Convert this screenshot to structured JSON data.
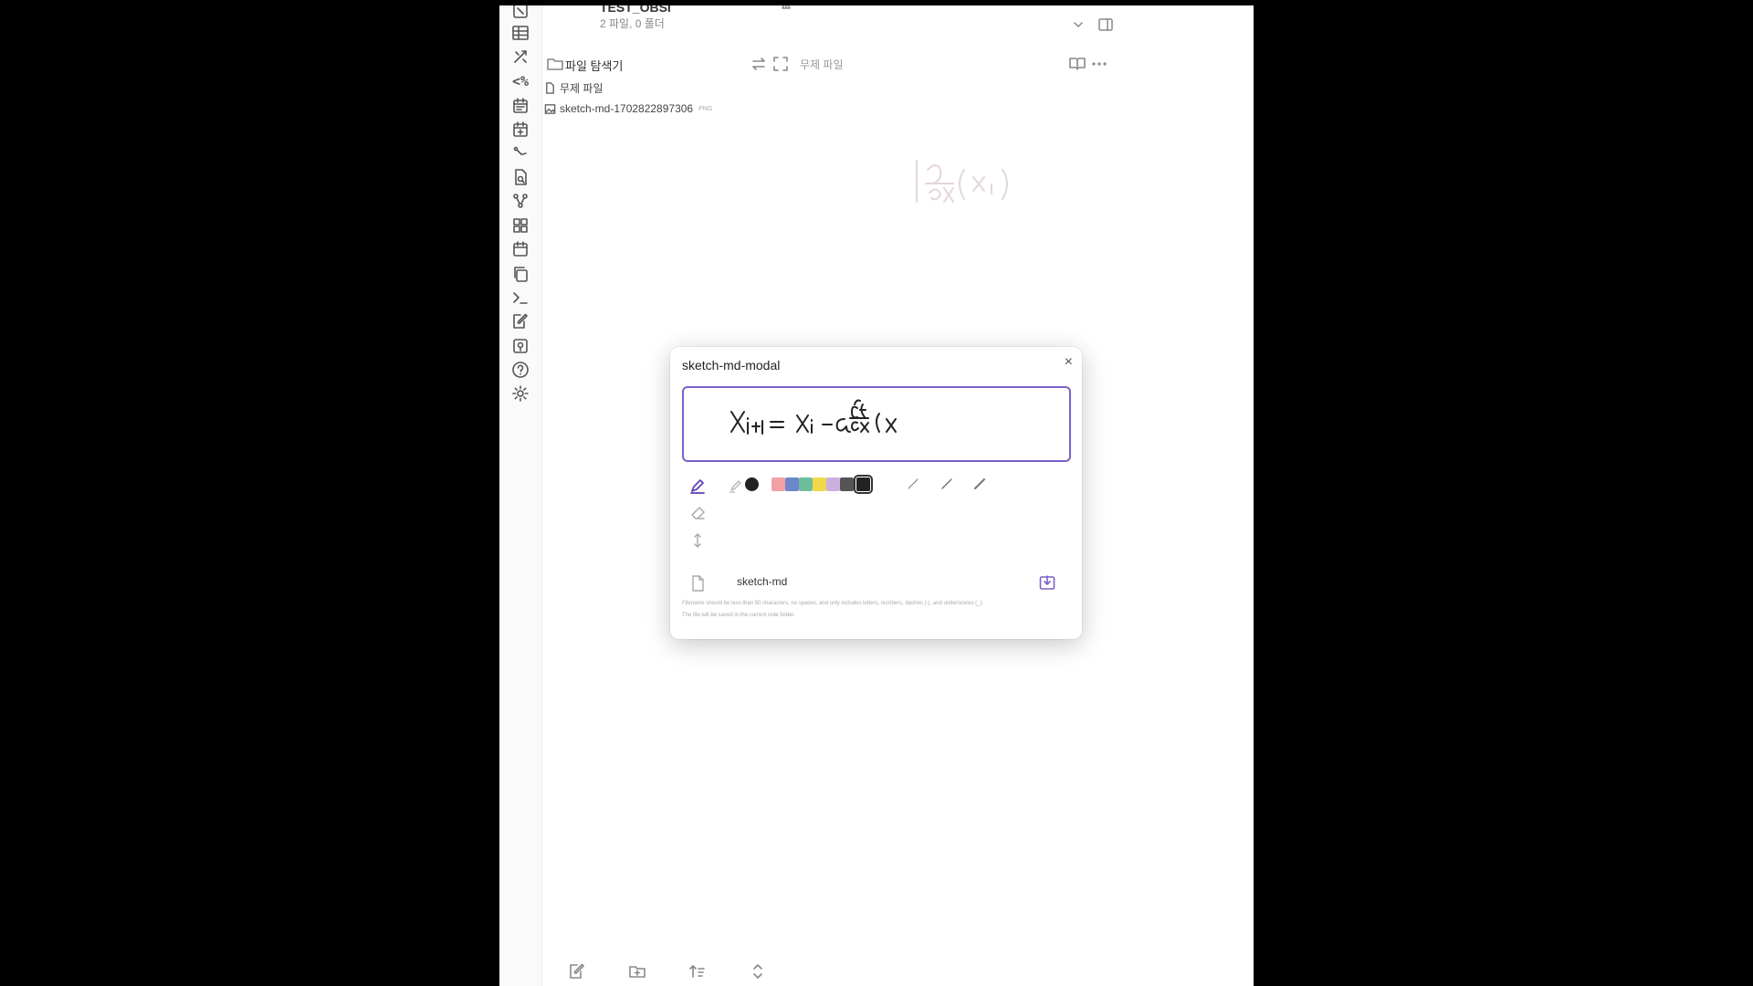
{
  "vault": {
    "name": "TEST_OBSI",
    "subtitle": "2 파일, 0 폴더"
  },
  "pane": {
    "title": "파일 탐색기",
    "tab_label": "무제 파일"
  },
  "files": [
    {
      "name": "무제 파일",
      "ext": "",
      "icon": "file-icon"
    },
    {
      "name": "sketch-md-1702822897306",
      "ext": "PNG",
      "icon": "image-icon"
    }
  ],
  "ribbon_icons": [
    "switcher-icon",
    "table-icon",
    "tools-icon",
    "templater-icon",
    "daily-note-icon",
    "calendar-plus-icon",
    "git-icon",
    "search-file-icon",
    "graph-icon",
    "dashboard-icon",
    "calendar-icon",
    "copy-icon",
    "terminal-icon",
    "edit-note-icon",
    "map-pin-icon",
    "help-icon",
    "settings-icon"
  ],
  "modal": {
    "title": "sketch-md-modal",
    "close": "×",
    "filename": "sketch-md",
    "hint1": "Filename should be less than 50 characters, no spaces, and only includes letters, numbers, dashes (-), and underscores (_).",
    "hint2": "The file will be saved in the current note folder."
  },
  "colors": {
    "accent": "#7b61c9",
    "palette": [
      "#f2a0a6",
      "#6d86c9",
      "#6cbf9a",
      "#f0d84a",
      "#cbb0de",
      "#555555",
      "#222222"
    ],
    "selected_palette_index": 6
  }
}
